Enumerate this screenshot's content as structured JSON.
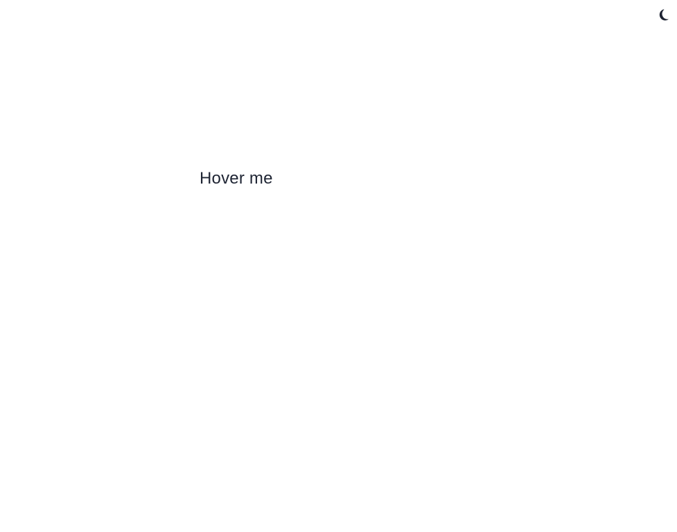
{
  "header": {
    "theme_toggle_icon": "moon-icon",
    "colors": {
      "icon": "#1e2433"
    }
  },
  "main": {
    "hover_text": "Hover me"
  },
  "colors": {
    "background": "#ffffff",
    "text": "#1e2433"
  }
}
